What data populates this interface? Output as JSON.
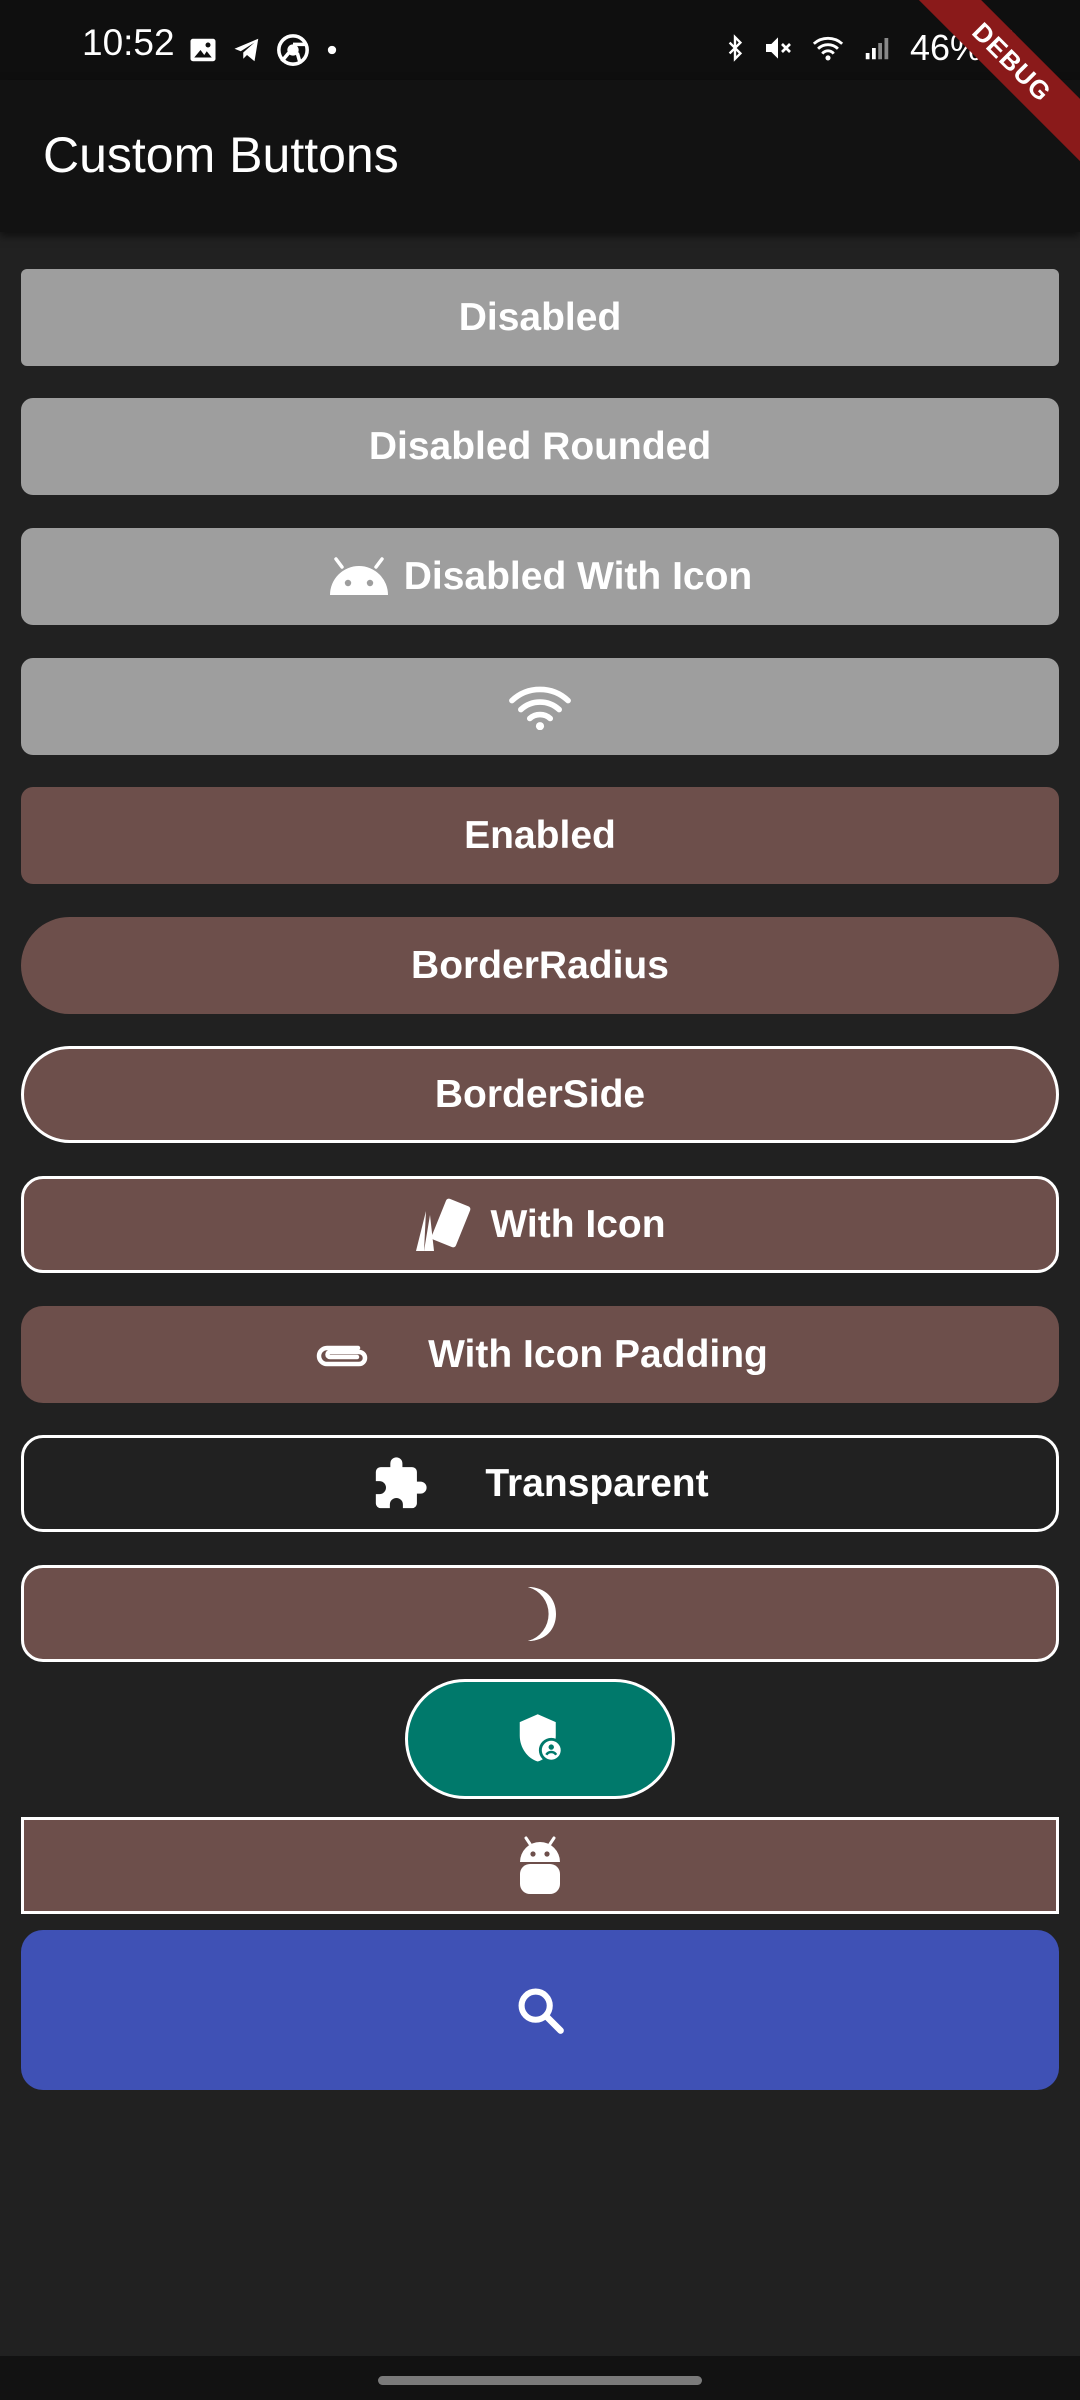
{
  "status_bar": {
    "time": "10:52",
    "battery": "46%",
    "left_icons": [
      "image-icon",
      "telegram-icon",
      "chrome-icon",
      "dot-icon"
    ],
    "right_icons": [
      "bluetooth-icon",
      "mute-icon",
      "wifi-icon",
      "signal-icon",
      "battery-icon"
    ]
  },
  "debug_banner": "DEBUG",
  "app_bar": {
    "title": "Custom Buttons"
  },
  "buttons": {
    "disabled": "Disabled",
    "disabled_rounded": "Disabled Rounded",
    "disabled_with_icon": "Disabled With Icon",
    "enabled": "Enabled",
    "border_radius": "BorderRadius",
    "border_side": "BorderSide",
    "with_icon": "With Icon",
    "with_icon_padding": "With Icon Padding",
    "transparent": "Transparent"
  },
  "icons": {
    "disabled_with_icon": "android-icon",
    "wifi_button": "wifi-icon",
    "with_icon": "cards-icon",
    "with_icon_padding": "paperclip-icon",
    "transparent": "puzzle-icon",
    "moon_button": "moon-icon",
    "shield_button": "admin-shield-icon",
    "android_button": "android-head-icon",
    "search_button": "search-icon"
  },
  "colors": {
    "background": "#212121",
    "disabled": "#9e9e9e",
    "brown": "#6d4f4b",
    "teal": "#00796b",
    "indigo": "#3f51b5",
    "debug": "#8a1a1a"
  }
}
